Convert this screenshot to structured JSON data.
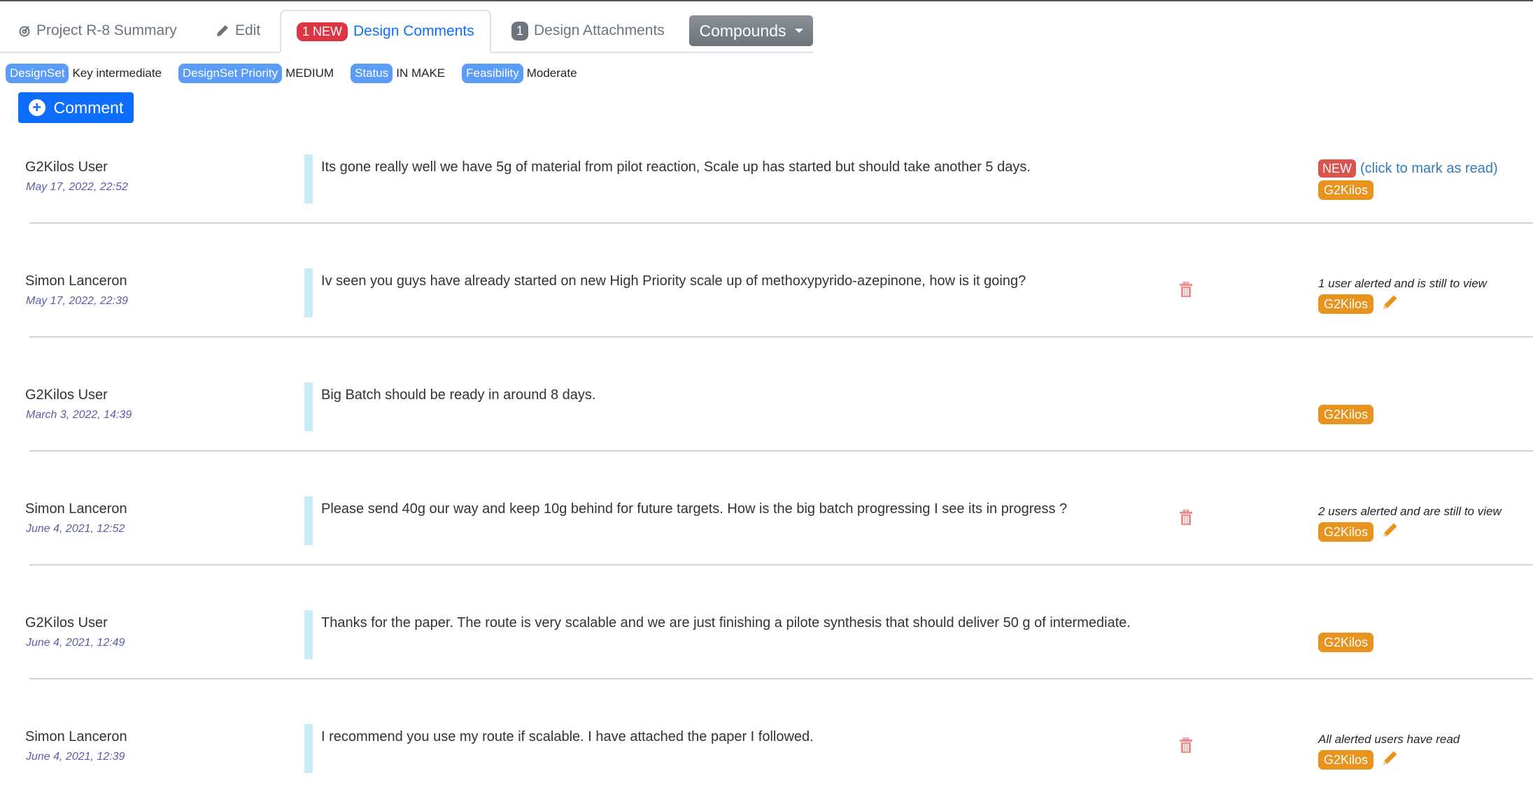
{
  "tabs": {
    "summary": {
      "label": "Project R-8 Summary",
      "icon": "target-icon"
    },
    "edit": {
      "label": "Edit",
      "icon": "pencil-icon"
    },
    "comments": {
      "badge": "1 NEW",
      "label": "Design Comments",
      "active": true
    },
    "attachments": {
      "badge": "1",
      "label": "Design Attachments"
    },
    "compounds": {
      "label": "Compounds"
    }
  },
  "meta": [
    {
      "badge": "DesignSet",
      "value": "Key intermediate"
    },
    {
      "badge": "DesignSet Priority",
      "value": "MEDIUM"
    },
    {
      "badge": "Status",
      "value": "IN MAKE"
    },
    {
      "badge": "Feasibility",
      "value": "Moderate"
    }
  ],
  "comment_button": {
    "label": "Comment"
  },
  "comments": [
    {
      "author": "G2Kilos User",
      "date": "May 17, 2022, 22:52",
      "text": "Its gone really well we have 5g of material from pilot reaction, Scale up has started but should take another 5 days.",
      "new_badge": "NEW",
      "mark_read": "(click to mark as read)",
      "team": "G2Kilos"
    },
    {
      "author": "Simon Lanceron",
      "date": "May 17, 2022, 22:39",
      "text": "Iv seen you guys have already started on new High Priority scale up of methoxypyrido-azepinone, how is it going?",
      "alert": "1 user alerted and is still to view",
      "team": "G2Kilos",
      "deletable": true,
      "editable": true
    },
    {
      "author": "G2Kilos User",
      "date": "March 3, 2022, 14:39",
      "text": "Big Batch should be ready in around 8 days.",
      "team": "G2Kilos"
    },
    {
      "author": "Simon Lanceron",
      "date": "June 4, 2021, 12:52",
      "text": "Please send 40g our way and keep 10g behind for future targets. How is the big batch progressing I see its in progress ?",
      "alert": "2 users alerted and are still to view",
      "team": "G2Kilos",
      "deletable": true,
      "editable": true
    },
    {
      "author": "G2Kilos User",
      "date": "June 4, 2021, 12:49",
      "text": "Thanks for the paper. The route is very scalable and we are just finishing a pilote synthesis that should deliver 50 g of intermediate.",
      "team": "G2Kilos"
    },
    {
      "author": "Simon Lanceron",
      "date": "June 4, 2021, 12:39",
      "text": "I recommend you use my route if scalable. I have attached the paper I followed.",
      "alert": "All alerted users have read",
      "team": "G2Kilos",
      "deletable": true,
      "editable": true
    }
  ],
  "colors": {
    "primary": "#0d6efd",
    "new_badge": "#dc3545",
    "team_badge": "#e8931e",
    "meta_badge": "#5a9cf8",
    "trash": "#f28b8b",
    "date": "#5b5ea6",
    "quote_bar": "#c8ecf8"
  }
}
